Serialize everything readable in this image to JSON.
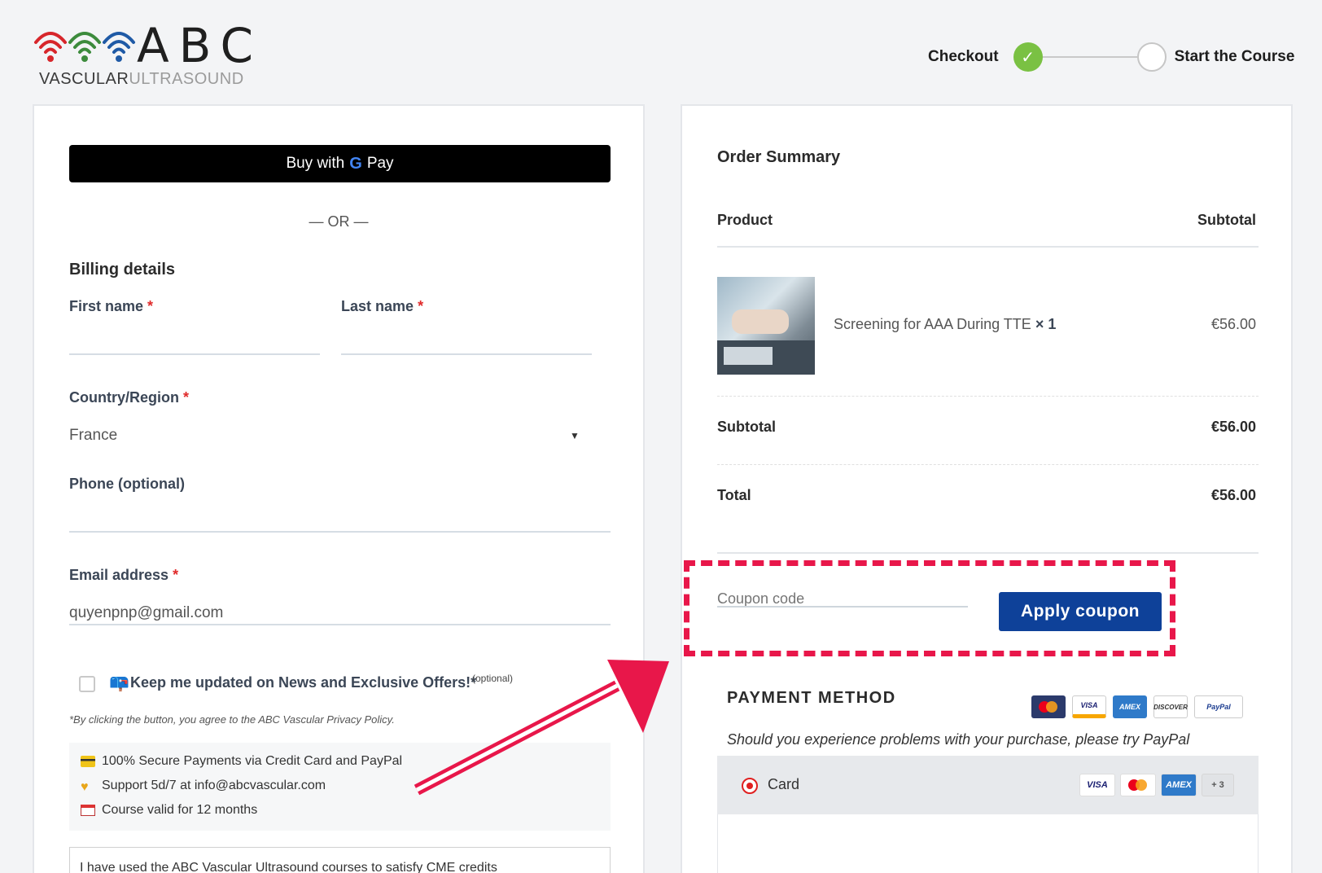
{
  "header": {
    "logo_main": "ABC",
    "logo_sub_a": "VASCULAR",
    "logo_sub_b": "ULTRASOUND",
    "steps": [
      {
        "label": "Checkout",
        "state": "done"
      },
      {
        "label": "Start the Course",
        "state": "todo"
      }
    ]
  },
  "left": {
    "gpay_prefix": "Buy with",
    "gpay_g": "G",
    "gpay_suffix": "Pay",
    "or_text": "— OR —",
    "billing_title": "Billing details",
    "first_name_label": "First name",
    "last_name_label": "Last name",
    "country_label": "Country/Region",
    "country_value": "France",
    "phone_label": "Phone (optional)",
    "email_label": "Email address",
    "email_value": "quyenpnp@gmail.com",
    "required_mark": "*",
    "newsletter_label": "Keep me updated on News and Exclusive Offers!*",
    "newsletter_optional": "(optional)",
    "disclaimer": "*By clicking the button, you agree to the ABC Vascular Privacy Policy.",
    "info": [
      "100% Secure Payments via Credit Card and PayPal",
      "Support 5d/7 at info@abcvascular.com",
      "Course valid for 12 months"
    ],
    "notes_text": "I have used the ABC Vascular Ultrasound courses to satisfy CME credits"
  },
  "right": {
    "order_title": "Order Summary",
    "col_product": "Product",
    "col_subtotal": "Subtotal",
    "product_name": "Screening for AAA During TTE",
    "product_qty": "× 1",
    "product_price": "€56.00",
    "subtotal_label": "Subtotal",
    "subtotal_value": "€56.00",
    "total_label": "Total",
    "total_value": "€56.00",
    "coupon_placeholder": "Coupon code",
    "apply_label": "Apply coupon",
    "payment_title": "PAYMENT METHOD",
    "payment_logos": [
      "mastercard",
      "VISA",
      "AMEX",
      "DISCOVER",
      "PayPal"
    ],
    "payment_note": "Should you experience problems with your purchase, please try PayPal",
    "card_label": "Card",
    "card_more": "+ 3"
  },
  "colors": {
    "accent_blue": "#0e4199",
    "step_done": "#7ac143",
    "highlight_red": "#e8174a",
    "required_red": "#e02b2b"
  }
}
